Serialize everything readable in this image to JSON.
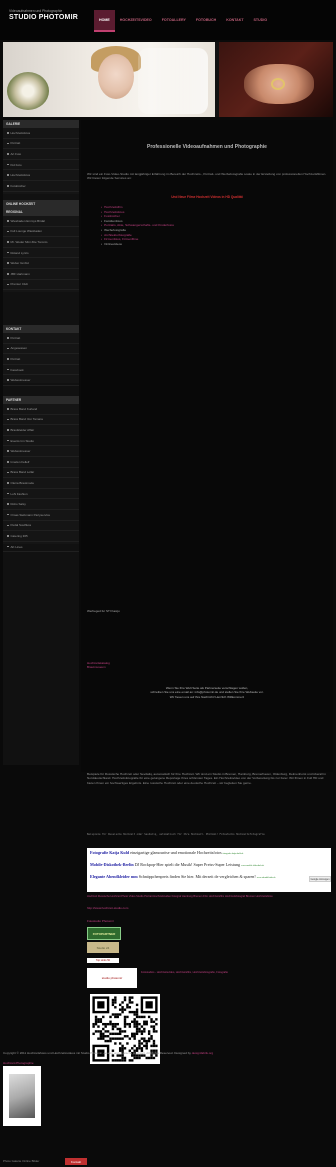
{
  "header": {
    "subtitle": "Videoaufnahmen und Photographie",
    "title": "STUDIO PHOTOMIR",
    "nav": [
      {
        "label": "HOME",
        "active": true
      },
      {
        "label": "HOCHZEITSVIDEO",
        "active": false
      },
      {
        "label": "FOTOALLERY",
        "active": false
      },
      {
        "label": "FOTOBUCH",
        "active": false
      },
      {
        "label": "KONTAKT",
        "active": false
      },
      {
        "label": "STUDIO",
        "active": false
      }
    ]
  },
  "sidebar": {
    "galerie": {
      "title": "GALERIE",
      "items": [
        "Hochzeitsfotos",
        "Portrait",
        "Art Foto",
        "Kid Foto",
        "Hochzeitsfotos",
        "Fotobücher"
      ]
    },
    "online": {
      "title": "ONLINE HOCHZEIT",
      "items": [
        "Galerie & Webfotos"
      ]
    },
    "regional": {
      "title": "REGIONAL",
      "items": [
        "Wiesbaden Emmys Bridal",
        "Full Lounge Wiesbaden",
        "Mr. Weder Mini Ztte Toronto",
        "Roland Lyrics",
        "Weber GmbH",
        "JBF Hartmann",
        "Premier Club"
      ]
    },
    "kontakt": {
      "title": "KONTAKT",
      "items": [
        "Portrait",
        "Angesessen",
        "Portrait",
        "Facebook",
        "Webestmesser"
      ]
    },
    "partner": {
      "title": "PARTNER",
      "items": [
        "Brass Band Kurland",
        "Brass Band Von Tamara",
        "Brautkleider Affair",
        "Events Inn Studio",
        "Webestmesser",
        "Innefen Fellelf",
        "Brass Band Lollar",
        "Oleria Brautmode",
        "LoN Fashion",
        "Robo Salsy",
        "Omas Siebmann Partyservice",
        "Pedal Soulfluss",
        "Catering 365",
        "AK Lines"
      ]
    }
  },
  "main": {
    "title": "Professionelle Videoaufnahmen und Photographie",
    "intro": "Wir sind ein Foto-Video-Studio mit langjähriger Erfahrung im Bereich der Hochzeits-, Portrait- und Werbefotografie sowie in der Erstellung von professionellen Hochzeitsfilmen. Wir bieten folgende Services an:",
    "highlight": "Und Neue Filme Hochzeit Videos in HD Qualität",
    "services": [
      {
        "text": "Hochzeitsfilm",
        "pink": true
      },
      {
        "text": "Hochzeitsfotos",
        "pink": true
      },
      {
        "text": "Fotobücher",
        "pink": true
      },
      {
        "text": "Familienfotos",
        "pink": false
      },
      {
        "text": "Portraits, Akte, Schwangerschafts- und Kinderfotos",
        "pink": true
      },
      {
        "text": "Werbefotografie",
        "pink": false
      },
      {
        "text": "Architekturfotografie",
        "pink": true
      },
      {
        "text": "Firmenfotos, Firmenfilme",
        "pink": true
      },
      {
        "text": "Onlinevideos",
        "pink": false
      }
    ],
    "workspace": "Werbeged fur STI Kasiju",
    "pink_links": [
      "Hochzeitskatalog",
      "Brautmuseum"
    ],
    "center_lines": [
      "Wenn Sie Ihre Welt Seite als Partnerseite verschlagen wollen,",
      "schreiben Sie uns eine email an: info@photomir.de und stellen Sie Ihre Webseite vor.",
      "Wir freuen uns auf Ihre Nachricht! Herzlich Willkommen!"
    ]
  },
  "lower": {
    "paragraph": "Beispiele für Russische Hochzeit oder Sevdaliq, automatisch für Ihre Hochzeit. Wir sind ein Studio in Bremen, Hamburg, Bremerhaven, Oldenburg, Delmenhorst und überall in Norddeutschland. Hochzeitsfotografie für eine gelungene Reportage Ihres schönsten Tages. Ein Hochzeitsvideo von der Vorbereitung bis zur Feier. Wir filmen in Full HD und bieten Ihnen ein hochwertiges Ergebnis. Eine russische Hochzeit oder eine deutsche Hochzeit – wir begleiten Sie gerne.",
    "mono": "Beispiele für Russische Hochzeit oder Sevdaliq, automatisch für Ihre Hochzeit. Photomir Fotostudio Hochzeitsfotografie",
    "ads": [
      {
        "bold": "Fotografie Katja Kuld",
        "text": " einzigartige glamouröse und emotionale Hochzeitsfotos",
        "url": "fotografie-katja-kuld.de"
      },
      {
        "bold": "Mobile-Diskothek-Berlin",
        "text": " DJ Rockpop-Hier spielt die Musik! Super Preiss-Super Leistung",
        "url": "www.mobile-diskothek.de"
      },
      {
        "bold": "Elegante Abendkleider mm",
        "text": " Schnäppchenpreis finden Sie hier. Mit derzeit de vergleichen & sparen!",
        "url": "www.abendkleider.de"
      }
    ],
    "google_badge": "Google Anzeigen",
    "tags": "Hochzeit Russische Hochzeit Photo Video Studio Portrait Hochzeitsvideo Fotograf Hamburg Bremen Film Hochzeitsfilm Hochzeitsfotograf Bremen Hochzeitsfotos",
    "url": "http://www.hochzeit-studio.com",
    "fotostudio": "Fotostudio Photomir",
    "badge1": "FOTOPARTNER",
    "badge2": "Studio 24",
    "badge3": "Top Links 50",
    "badge4": "studio photomir",
    "cat_line": "Fotostudios - Hochzeitsvideo, Hochzeitsfilm, Hochzeitsfotografie, Fotografie"
  },
  "footer": {
    "copyright": "Copyright © 2011 Hochzeitsfotos und Hochzeitsvideos mit Studio Photomir, Analog und russische Hochzeit. All Rights Reserved. Designed by",
    "designer": "designfabrik.org",
    "link": "Hochzeit-Photographie",
    "thumb_caption": "Photo Galerie Online Bilder",
    "button": "Kontakt"
  }
}
